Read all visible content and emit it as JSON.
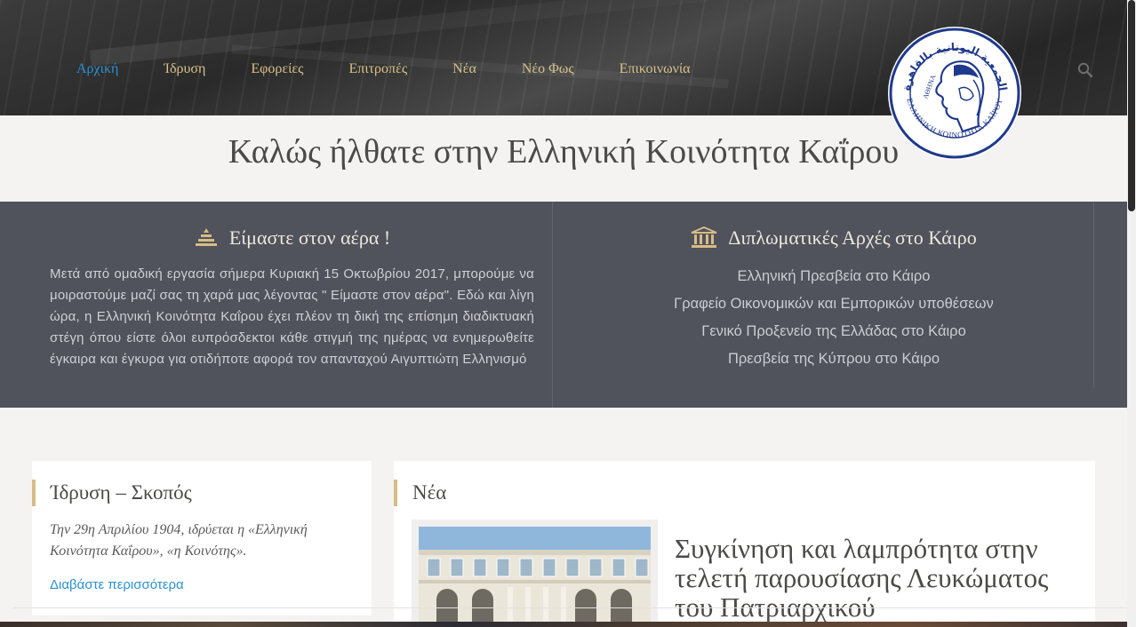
{
  "nav": {
    "items": [
      {
        "label": "Αρχική",
        "active": true
      },
      {
        "label": "Ίδρυση",
        "active": false
      },
      {
        "label": "Εφορείες",
        "active": false
      },
      {
        "label": "Επιτροπές",
        "active": false
      },
      {
        "label": "Νέα",
        "active": false
      },
      {
        "label": "Νέο Φως",
        "active": false
      },
      {
        "label": "Επικοινωνία",
        "active": false
      }
    ],
    "search_icon": "search-icon"
  },
  "logo": {
    "arabic_text": "الجمعية اليونانية بالقاهرة",
    "greek_text": "ΕΛΛΗΝΙΚΗ ΚΟΙΝΟΤΗΤΑ ΚΑΪΡΟΥ",
    "monogram": "ΑΘΗΝΑ"
  },
  "welcome": {
    "title": "Καλώς ήλθατε στην Ελληνική Κοινότητα Καΐρου"
  },
  "info": {
    "left": {
      "title": "Είμαστε στον αέρα !",
      "icon": "pyramid-icon",
      "text": "Μετά από ομαδική εργασία σήμερα Κυριακή 15 Οκτωβρίου 2017, μπορούμε να μοιραστούμε μαζί σας τη χαρά μας λέγοντας \" Είμαστε στον αέρα\". Εδώ και λίγη ώρα, η Ελληνική Κοινότητα Καΐρου έχει πλέον τη δική της επίσημη διαδικτυακή στέγη όπου είστε όλοι ευπρόσδεκτοι κάθε στιγμή της ημέρας να ενημερωθείτε έγκαιρα και έγκυρα για οτιδήποτε αφορά τον απανταχού Αιγυπτιώτη Ελληνισμό"
    },
    "right": {
      "title": "Διπλωματικές Αρχές στο Κάιρο",
      "icon": "embassy-icon",
      "links": [
        "Ελληνική Πρεσβεία στο Κάιρο",
        "Γραφείο Οικονομικών και Εμπορικών υποθέσεων",
        "Γενικό Προξενείο της Ελλάδας στο Κάιρο",
        "Πρεσβεία της Κύπρου στο Κάιρο"
      ]
    }
  },
  "founding": {
    "heading": "Ίδρυση – Σκοπός",
    "text": "Την 29η Απριλίου 1904, ιδρύεται η «Ελληνική Κοινότητα Καΐρου», «η Κοινότης».",
    "more_label": "Διαβάστε περισσότερα"
  },
  "news": {
    "heading": "Νέα",
    "article_title": "Συγκίνηση και λαμπρότητα στην τελετή παρουσίασης Λευκώματος του Πατριαρχικού",
    "thumbnail": "building-photo"
  },
  "colors": {
    "accent": "#2a91d0",
    "gold": "#d8c08a",
    "band": "#50525c"
  }
}
